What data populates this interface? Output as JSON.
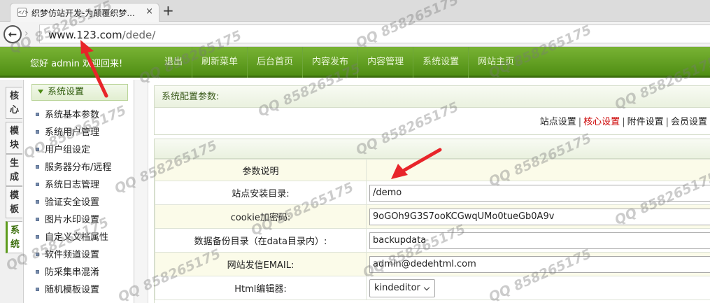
{
  "browser": {
    "tab_title": "织梦仿站开发-为颠覆织梦...",
    "tab_close": "×",
    "new_tab": "+",
    "favicon": "</>",
    "back": "←",
    "forward": "›",
    "url_host": "www.123.com",
    "url_path": "/dede/"
  },
  "topnav": {
    "welcome": "您好 admin 欢迎回来!",
    "links": [
      "退出",
      "刷新菜单",
      "后台首页",
      "内容发布",
      "内容管理",
      "系统设置",
      "网站主页"
    ]
  },
  "sidetabs": [
    "核心",
    "模块",
    "生成",
    "模板",
    "系统"
  ],
  "sidetab_active": "系统",
  "leftmenu": {
    "header": "系统设置",
    "items": [
      "系统基本参数",
      "系统用户管理",
      "用户组设定",
      "服务器分布/远程",
      "系统日志管理",
      "验证安全设置",
      "图片水印设置",
      "自定义文档属性",
      "软件频道设置",
      "防采集串混淆",
      "随机模板设置"
    ]
  },
  "main": {
    "panel_title": "系统配置参数:",
    "crumbs": [
      "站点设置",
      "核心设置",
      "附件设置",
      "会员设置"
    ],
    "crumb_separator": "|",
    "table_header": "参数说明",
    "rows": [
      {
        "label": "站点安装目录:",
        "value": "/demo"
      },
      {
        "label": "cookie加密码:",
        "value": "9oGOh9G3S7ooKCGwqUMo0tueGb0A9v"
      },
      {
        "label": "数据备份目录（在data目录内）:",
        "value": "backupdata"
      },
      {
        "label": "网站发信EMAIL:",
        "value": "admin@dedehtml.com"
      },
      {
        "label": "Html编辑器:",
        "value": "kindeditor"
      }
    ]
  },
  "watermark": "QQ 858265175",
  "colors": {
    "nav_green": "#5d9b1c",
    "active_crumb": "#cc0000",
    "annotation_arrow": "#e8252a"
  }
}
